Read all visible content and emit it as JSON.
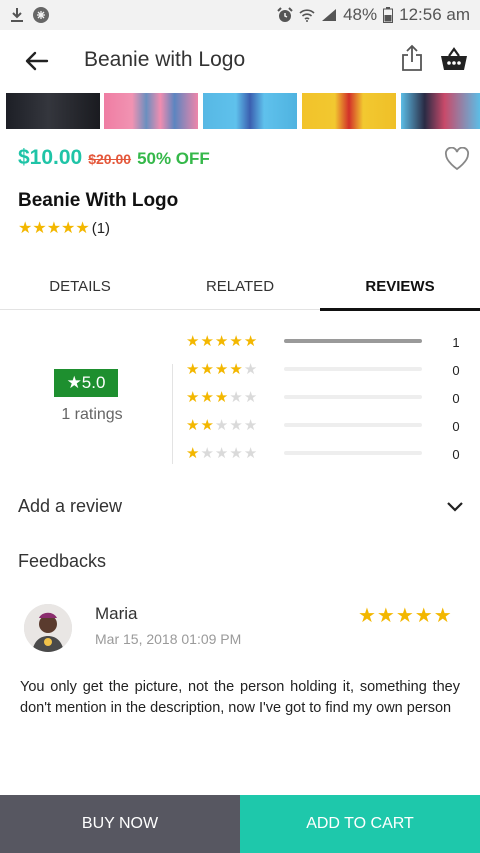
{
  "status_bar": {
    "battery": "48%",
    "time": "12:56 am",
    "icons": [
      "download-icon",
      "notification-icon",
      "alarm-icon",
      "wifi-icon",
      "signal-icon",
      "battery-icon"
    ]
  },
  "header": {
    "title": "Beanie with Logo",
    "icons": [
      "back-arrow-icon",
      "share-icon",
      "basket-icon"
    ]
  },
  "product": {
    "price": "$10.00",
    "old_price": "$20.00",
    "discount": "50% OFF",
    "name": "Beanie With Logo",
    "stars": "★★★★★",
    "review_count": "(1)"
  },
  "tabs": [
    {
      "label": "DETAILS",
      "active": false
    },
    {
      "label": "RELATED",
      "active": false
    },
    {
      "label": "REVIEWS",
      "active": true
    }
  ],
  "rating_summary": {
    "average": "★5.0",
    "ratings_label": "1 ratings",
    "breakdown": [
      {
        "stars": 5,
        "count": "1",
        "fill": 1.0
      },
      {
        "stars": 4,
        "count": "0",
        "fill": 0
      },
      {
        "stars": 3,
        "count": "0",
        "fill": 0
      },
      {
        "stars": 2,
        "count": "0",
        "fill": 0
      },
      {
        "stars": 1,
        "count": "0",
        "fill": 0
      }
    ]
  },
  "add_review": {
    "label": "Add a review"
  },
  "feedbacks": {
    "label": "Feedbacks"
  },
  "review": {
    "name": "Maria",
    "date": "Mar 15, 2018 01:09 PM",
    "stars": "★★★★★",
    "text": "You only get the picture, not the person holding it, something they don't mention in the description, now I've got to find my own person"
  },
  "actions": {
    "buy_now": "BUY NOW",
    "add_to_cart": "ADD TO CART"
  },
  "colors": {
    "price": "#1fc4a7",
    "old_price": "#e4573a",
    "discount": "#35b84a",
    "star": "#f3b700",
    "rating_badge": "#1e8f2f",
    "buy_now_bg": "#575761",
    "add_to_cart_bg": "#1ec8ab"
  }
}
